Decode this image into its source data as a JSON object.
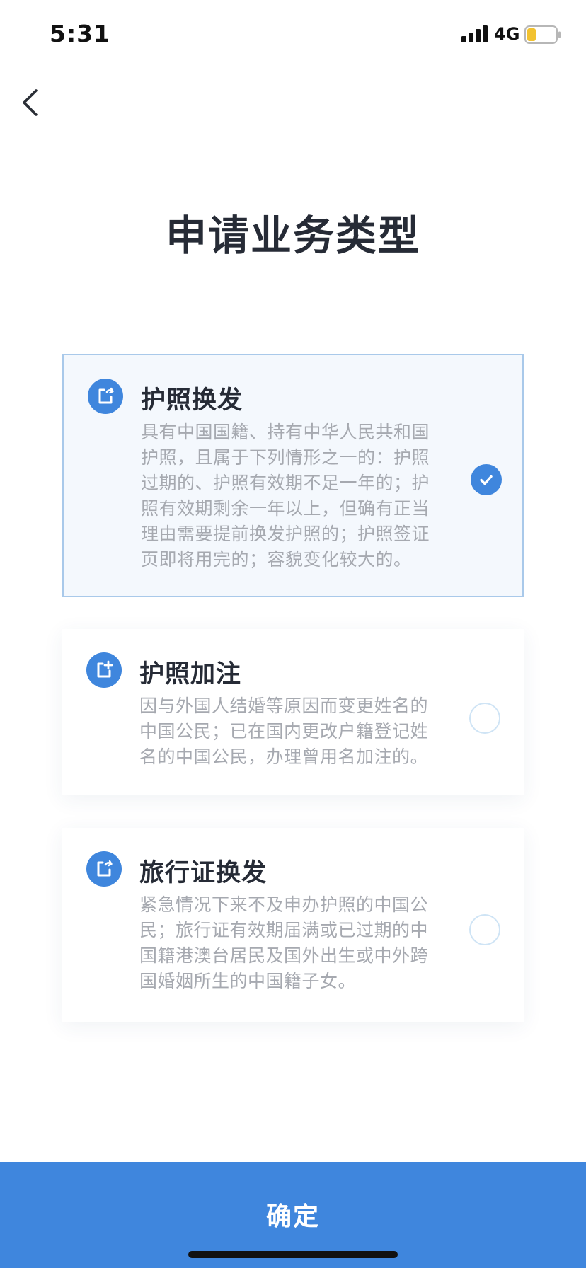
{
  "status_bar": {
    "time": "5:31",
    "network": "4G",
    "battery_color": "#f2c230"
  },
  "header": {
    "title": "申请业务类型"
  },
  "options": [
    {
      "title": "护照换发",
      "description": "具有中国国籍、持有中华人民共和国护照，且属于下列情形之一的：护照过期的、护照有效期不足一年的；护照有效期剩余一年以上，但确有正当理由需要提前换发护照的；护照签证页即将用完的；容貌变化较大的。",
      "icon": "document-refresh-icon",
      "selected": true
    },
    {
      "title": "护照加注",
      "description": "因与外国人结婚等原因而变更姓名的中国公民；已在国内更改户籍登记姓名的中国公民，办理曾用名加注的。",
      "icon": "document-add-icon",
      "selected": false
    },
    {
      "title": "旅行证换发",
      "description": "紧急情况下来不及申办护照的中国公民；旅行证有效期届满或已过期的中国籍港澳台居民及国外出生或中外跨国婚姻所生的中国籍子女。",
      "icon": "document-refresh-icon",
      "selected": false
    }
  ],
  "footer": {
    "confirm_label": "确定"
  },
  "colors": {
    "accent": "#3f86dd",
    "selected_border": "#a9c9ea",
    "selected_bg": "#f4f8fd",
    "description_text": "#a6a9b0"
  }
}
